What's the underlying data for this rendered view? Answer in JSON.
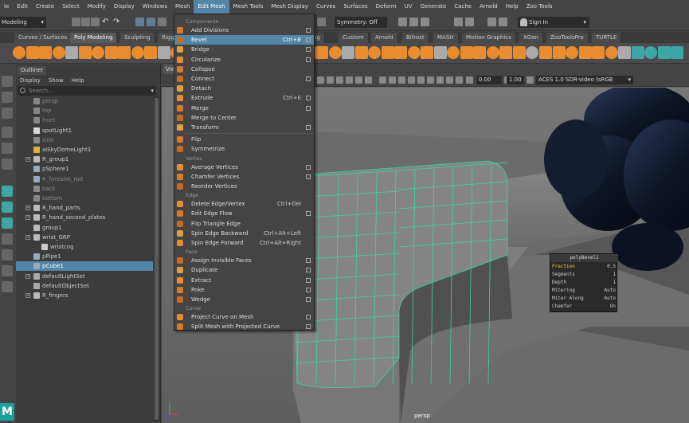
{
  "menubar": {
    "items": [
      "le",
      "Edit",
      "Create",
      "Select",
      "Modify",
      "Display",
      "Windows",
      "Mesh",
      "Edit Mesh",
      "Mesh Tools",
      "Mesh Display",
      "Curves",
      "Surfaces",
      "Deform",
      "UV",
      "Generate",
      "Cache",
      "Arnold",
      "Help",
      "Zoo Tools"
    ],
    "active_index": 8
  },
  "statusline": {
    "mode": "Modeling",
    "symmetry": "Symmetry: Off",
    "signin": "Sign In"
  },
  "shelf": {
    "tabs": [
      "Curves / Surfaces",
      "Poly Modeling",
      "Sculpting",
      "Rigg",
      "shing",
      "Custom",
      "Arnold",
      "Bifrost",
      "MASH",
      "Motion Graphics",
      "XGen",
      "ZooToolsPro",
      "TURTLE"
    ],
    "active_index": 1
  },
  "outliner": {
    "tab": "Outliner",
    "menu": [
      "Display",
      "Show",
      "Help"
    ],
    "search_placeholder": "Search...",
    "items": [
      {
        "label": "persp",
        "icon": "camera-icon",
        "dim": true,
        "expand": false,
        "indent": 0
      },
      {
        "label": "top",
        "icon": "camera-icon",
        "dim": true,
        "expand": false,
        "indent": 0
      },
      {
        "label": "front",
        "icon": "camera-icon",
        "dim": true,
        "expand": false,
        "indent": 0
      },
      {
        "label": "spotLight1",
        "icon": "spotlight-icon",
        "dim": false,
        "expand": false,
        "indent": 0
      },
      {
        "label": "side",
        "icon": "camera-icon",
        "dim": true,
        "expand": false,
        "indent": 0
      },
      {
        "label": "aiSkyDomeLight1",
        "icon": "skydome-icon",
        "dim": false,
        "expand": false,
        "indent": 0
      },
      {
        "label": "R_group1",
        "icon": "group-icon",
        "dim": false,
        "expand": true,
        "indent": 0
      },
      {
        "label": "pSphere1",
        "icon": "mesh-icon",
        "dim": false,
        "expand": false,
        "indent": 0
      },
      {
        "label": "R_forearm_rod",
        "icon": "mesh-icon",
        "dim": true,
        "expand": false,
        "indent": 0
      },
      {
        "label": "back",
        "icon": "camera-icon",
        "dim": true,
        "expand": false,
        "indent": 0
      },
      {
        "label": "bottom",
        "icon": "camera-icon",
        "dim": true,
        "expand": false,
        "indent": 0
      },
      {
        "label": "R_hand_parts",
        "icon": "group-icon",
        "dim": false,
        "expand": true,
        "indent": 0
      },
      {
        "label": "R_hand_second_plates",
        "icon": "group-icon",
        "dim": false,
        "expand": true,
        "indent": 0
      },
      {
        "label": "group1",
        "icon": "group-icon",
        "dim": false,
        "expand": false,
        "indent": 0
      },
      {
        "label": "wrist_GRP",
        "icon": "group-icon",
        "dim": false,
        "expand": true,
        "indent": 0
      },
      {
        "label": "wristcog",
        "icon": "joint-icon",
        "dim": false,
        "expand": false,
        "indent": 1
      },
      {
        "label": "pPipe1",
        "icon": "mesh-icon",
        "dim": false,
        "expand": false,
        "indent": 0
      },
      {
        "label": "pCube1",
        "icon": "mesh-icon",
        "dim": false,
        "expand": false,
        "indent": 0,
        "selected": true
      },
      {
        "label": "defaultLightSet",
        "icon": "set-icon",
        "dim": false,
        "expand": true,
        "indent": 0
      },
      {
        "label": "defaultObjectSet",
        "icon": "set-icon",
        "dim": false,
        "expand": false,
        "indent": 0
      },
      {
        "label": "R_fingers",
        "icon": "group-icon",
        "dim": false,
        "expand": true,
        "indent": 0
      }
    ]
  },
  "viewport": {
    "tab": "Vie",
    "value1": "0.00",
    "value2": "1.00",
    "colorspace": "ACES 1.0 SDR-video (sRGB",
    "camera": "persp"
  },
  "bevel_box": {
    "title": "polyBevel1",
    "rows": [
      {
        "label": "Fraction",
        "value": "0.5",
        "highlight": true
      },
      {
        "label": "Segments",
        "value": "1",
        "highlight": false
      },
      {
        "label": "Depth",
        "value": "1",
        "highlight": false
      },
      {
        "label": "Mitering",
        "value": "Auto",
        "highlight": false
      },
      {
        "label": "Miter Along",
        "value": "Auto",
        "highlight": false
      },
      {
        "label": "Chamfer",
        "value": "On",
        "highlight": false
      }
    ]
  },
  "edit_mesh_menu": {
    "entries": [
      {
        "type": "section",
        "label": "Components"
      },
      {
        "type": "item",
        "label": "Add Divisions",
        "shortcut": "",
        "box": true,
        "icon": "add-divisions-icon"
      },
      {
        "type": "item",
        "label": "Bevel",
        "shortcut": "Ctrl+B",
        "box": true,
        "icon": "bevel-icon",
        "highlight": true
      },
      {
        "type": "item",
        "label": "Bridge",
        "shortcut": "",
        "box": true,
        "icon": "bridge-icon"
      },
      {
        "type": "item",
        "label": "Circularize",
        "shortcut": "",
        "box": true,
        "icon": "circularize-icon"
      },
      {
        "type": "item",
        "label": "Collapse",
        "shortcut": "",
        "box": false,
        "icon": "collapse-icon"
      },
      {
        "type": "item",
        "label": "Connect",
        "shortcut": "",
        "box": true,
        "icon": "connect-icon"
      },
      {
        "type": "item",
        "label": "Detach",
        "shortcut": "",
        "box": false,
        "icon": "detach-icon"
      },
      {
        "type": "item",
        "label": "Extrude",
        "shortcut": "Ctrl+E",
        "box": true,
        "icon": "extrude-icon"
      },
      {
        "type": "item",
        "label": "Merge",
        "shortcut": "",
        "box": true,
        "icon": "merge-icon"
      },
      {
        "type": "item",
        "label": "Merge to Center",
        "shortcut": "",
        "box": false,
        "icon": "merge-center-icon"
      },
      {
        "type": "item",
        "label": "Transform",
        "shortcut": "",
        "box": true,
        "icon": "transform-icon"
      },
      {
        "type": "sep"
      },
      {
        "type": "item",
        "label": "Flip",
        "shortcut": "",
        "box": false,
        "icon": "flip-icon"
      },
      {
        "type": "item",
        "label": "Symmetrize",
        "shortcut": "",
        "box": false,
        "icon": "symmetrize-icon"
      },
      {
        "type": "section",
        "label": "Vertex"
      },
      {
        "type": "item",
        "label": "Average Vertices",
        "shortcut": "",
        "box": true,
        "icon": "average-vertices-icon"
      },
      {
        "type": "item",
        "label": "Chamfer Vertices",
        "shortcut": "",
        "box": true,
        "icon": "chamfer-vertices-icon"
      },
      {
        "type": "item",
        "label": "Reorder Vertices",
        "shortcut": "",
        "box": false,
        "icon": "reorder-vertices-icon"
      },
      {
        "type": "section",
        "label": "Edge"
      },
      {
        "type": "item",
        "label": "Delete Edge/Vertex",
        "shortcut": "Ctrl+Del",
        "box": false,
        "icon": "delete-edge-icon"
      },
      {
        "type": "item",
        "label": "Edit Edge Flow",
        "shortcut": "",
        "box": true,
        "icon": "edit-edge-flow-icon"
      },
      {
        "type": "item",
        "label": "Flip Triangle Edge",
        "shortcut": "",
        "box": false,
        "icon": "flip-triangle-icon"
      },
      {
        "type": "item",
        "label": "Spin Edge Backward",
        "shortcut": "Ctrl+Alt+Left",
        "box": false,
        "icon": "spin-back-icon"
      },
      {
        "type": "item",
        "label": "Spin Edge Forward",
        "shortcut": "Ctrl+Alt+Right",
        "box": false,
        "icon": "spin-forward-icon"
      },
      {
        "type": "section",
        "label": "Face"
      },
      {
        "type": "item",
        "label": "Assign Invisible Faces",
        "shortcut": "",
        "box": true,
        "icon": "invisible-faces-icon"
      },
      {
        "type": "item",
        "label": "Duplicate",
        "shortcut": "",
        "box": true,
        "icon": "duplicate-icon"
      },
      {
        "type": "item",
        "label": "Extract",
        "shortcut": "",
        "box": true,
        "icon": "extract-icon"
      },
      {
        "type": "item",
        "label": "Poke",
        "shortcut": "",
        "box": true,
        "icon": "poke-icon"
      },
      {
        "type": "item",
        "label": "Wedge",
        "shortcut": "",
        "box": true,
        "icon": "wedge-icon"
      },
      {
        "type": "section",
        "label": "Curve"
      },
      {
        "type": "item",
        "label": "Project Curve on Mesh",
        "shortcut": "",
        "box": true,
        "icon": "project-curve-icon"
      },
      {
        "type": "item",
        "label": "Split Mesh with Projected Curve",
        "shortcut": "",
        "box": true,
        "icon": "split-mesh-icon"
      }
    ]
  },
  "colors": {
    "highlight": "#5285a6",
    "wireframe": "#38d6a6",
    "icon_orange": "#e98c2f",
    "icon_teal": "#3fa6a6"
  }
}
